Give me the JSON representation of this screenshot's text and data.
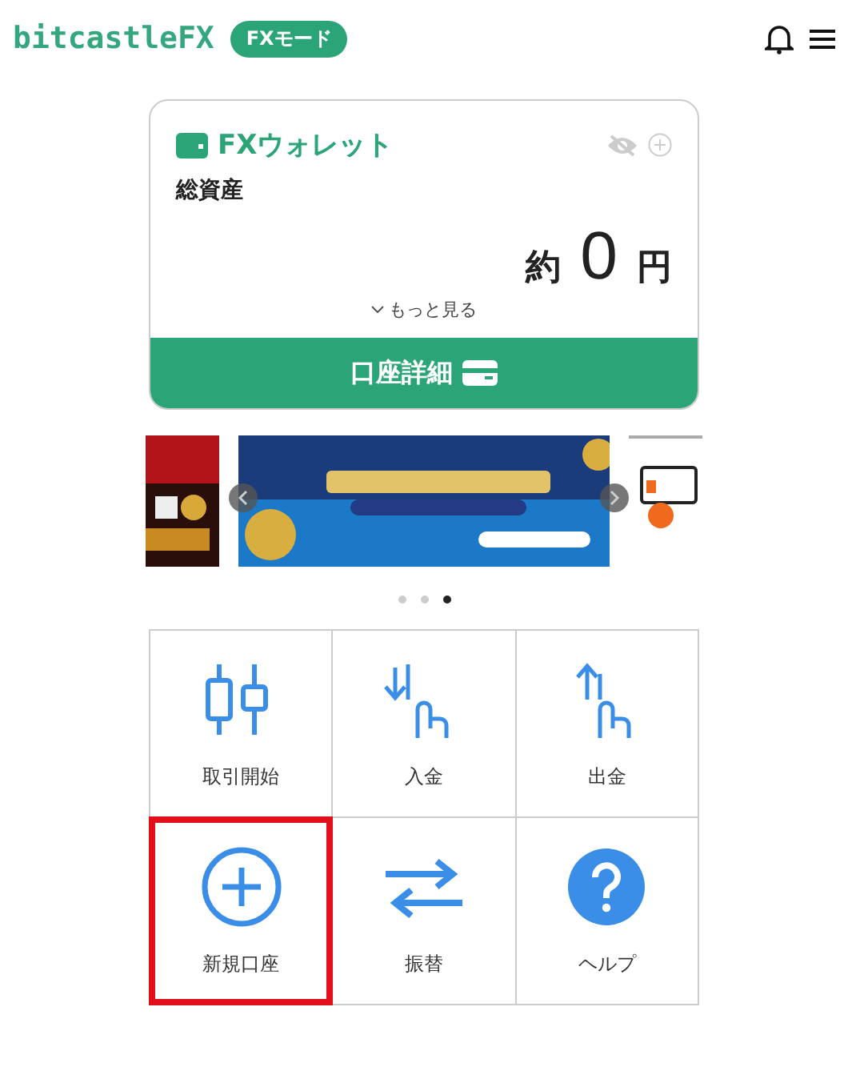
{
  "header": {
    "logo": "bitcastleFX",
    "mode_badge": "FXモード"
  },
  "wallet": {
    "title": "FXウォレット",
    "label": "総資産",
    "prefix": "約",
    "amount": "0",
    "unit": "円",
    "more": "もっと見る",
    "details_button": "口座詳細"
  },
  "carousel": {
    "dots": [
      {
        "selected": false
      },
      {
        "selected": false
      },
      {
        "selected": true
      }
    ]
  },
  "menu": [
    {
      "kind": "candles",
      "label": "取引開始",
      "highlighted": false
    },
    {
      "kind": "deposit",
      "label": "入金",
      "highlighted": false
    },
    {
      "kind": "withdraw",
      "label": "出金",
      "highlighted": false
    },
    {
      "kind": "plus",
      "label": "新規口座",
      "highlighted": true
    },
    {
      "kind": "transfer",
      "label": "振替",
      "highlighted": false
    },
    {
      "kind": "help",
      "label": "ヘルプ",
      "highlighted": false
    }
  ]
}
